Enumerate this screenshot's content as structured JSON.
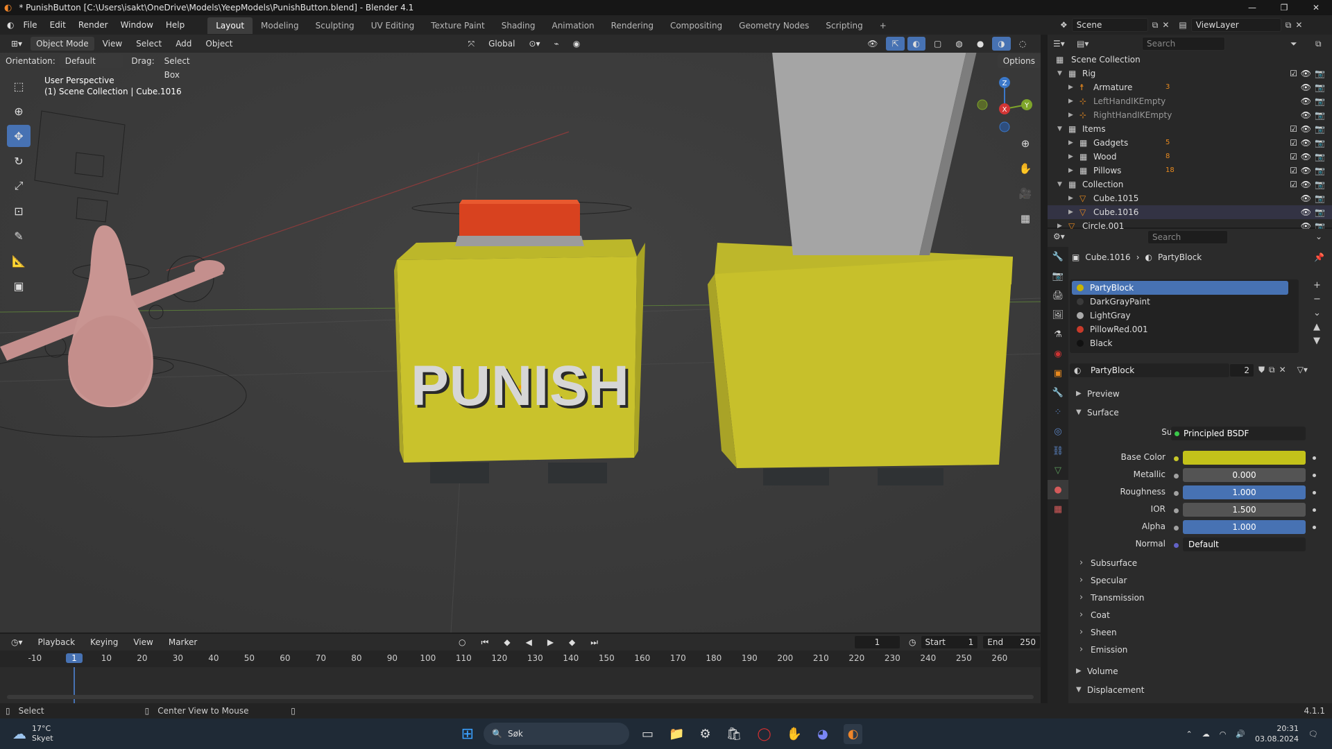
{
  "app": {
    "title": "* PunishButton [C:\\Users\\isakt\\OneDrive\\Models\\YeepModels\\PunishButton.blend] - Blender 4.1",
    "version": "4.1.1"
  },
  "window_controls": {
    "minimize": "—",
    "maximize": "❐",
    "close": "✕"
  },
  "menu": [
    "File",
    "Edit",
    "Render",
    "Window",
    "Help"
  ],
  "workspaces": {
    "items": [
      "Layout",
      "Modeling",
      "Sculpting",
      "UV Editing",
      "Texture Paint",
      "Shading",
      "Animation",
      "Rendering",
      "Compositing",
      "Geometry Nodes",
      "Scripting"
    ],
    "active": "Layout",
    "add": "+"
  },
  "scene": {
    "name": "Scene",
    "view_layer": "ViewLayer"
  },
  "viewport": {
    "mode": "Object Mode",
    "menus": [
      "View",
      "Select",
      "Add",
      "Object"
    ],
    "transform_orientation": "Global",
    "orientation_label": "Orientation:",
    "orientation_value": "Default",
    "drag_label": "Drag:",
    "drag_value": "Select Box",
    "options": "Options",
    "view_name": "User Perspective",
    "collection_info": "(1) Scene Collection | Cube.1016",
    "block_text": "PUNISH",
    "axis": {
      "x": "X",
      "y": "Y",
      "z": "Z"
    }
  },
  "timeline": {
    "menus": [
      "Playback",
      "Keying",
      "View",
      "Marker"
    ],
    "current_frame": "1",
    "start_label": "Start",
    "start": "1",
    "end_label": "End",
    "end": "250",
    "ruler": [
      "-10",
      "1",
      "10",
      "20",
      "30",
      "40",
      "50",
      "60",
      "70",
      "80",
      "90",
      "100",
      "110",
      "120",
      "130",
      "140",
      "150",
      "160",
      "170",
      "180",
      "190",
      "200",
      "210",
      "220",
      "230",
      "240",
      "250",
      "260"
    ]
  },
  "status": {
    "left": "Select",
    "middle": "Center View to Mouse",
    "version": "4.1.1"
  },
  "outliner": {
    "search_placeholder": "Search",
    "root": "Scene Collection",
    "rows": [
      {
        "label": "Rig",
        "indent": 1,
        "type": "collection",
        "badge": ""
      },
      {
        "label": "Armature",
        "indent": 2,
        "type": "armature",
        "badge": "3"
      },
      {
        "label": "LeftHandIKEmpty",
        "indent": 2,
        "type": "empty",
        "badge": "",
        "dim": true
      },
      {
        "label": "RightHandIKEmpty",
        "indent": 2,
        "type": "empty",
        "badge": "",
        "dim": true
      },
      {
        "label": "Items",
        "indent": 1,
        "type": "collection",
        "badge": ""
      },
      {
        "label": "Gadgets",
        "indent": 2,
        "type": "collection",
        "badge": "5"
      },
      {
        "label": "Wood",
        "indent": 2,
        "type": "collection",
        "badge": "8"
      },
      {
        "label": "Pillows",
        "indent": 2,
        "type": "collection",
        "badge": "18"
      },
      {
        "label": "Collection",
        "indent": 1,
        "type": "collection",
        "badge": ""
      },
      {
        "label": "Cube.1015",
        "indent": 2,
        "type": "mesh",
        "badge": ""
      },
      {
        "label": "Cube.1016",
        "indent": 2,
        "type": "mesh",
        "badge": ""
      },
      {
        "label": "Circle.001",
        "indent": 1,
        "type": "mesh",
        "badge": ""
      }
    ]
  },
  "properties": {
    "search_placeholder": "Search",
    "breadcrumb_object": "Cube.1016",
    "breadcrumb_material": "PartyBlock",
    "slots": [
      {
        "name": "PartyBlock",
        "color": "#c8b400",
        "selected": true
      },
      {
        "name": "DarkGrayPaint",
        "color": "#3a3a3a",
        "selected": false
      },
      {
        "name": "LightGray",
        "color": "#aaaaaa",
        "selected": false
      },
      {
        "name": "PillowRed.001",
        "color": "#c83a2a",
        "selected": false
      },
      {
        "name": "Black",
        "color": "#111111",
        "selected": false
      }
    ],
    "material_name": "PartyBlock",
    "users": "2",
    "sections_top": [
      "Preview",
      "Surface"
    ],
    "surface_label": "Surface",
    "surface_value": "Principled BSDF",
    "fields": [
      {
        "label": "Base Color",
        "value": "",
        "kind": "color",
        "color": "#c3c21a"
      },
      {
        "label": "Metallic",
        "value": "0.000",
        "kind": "num",
        "fill": 0
      },
      {
        "label": "Roughness",
        "value": "1.000",
        "kind": "num",
        "fill": 1
      },
      {
        "label": "IOR",
        "value": "1.500",
        "kind": "num",
        "fill": 0
      },
      {
        "label": "Alpha",
        "value": "1.000",
        "kind": "num",
        "fill": 1
      },
      {
        "label": "Normal",
        "value": "Default",
        "kind": "text"
      }
    ],
    "subsections": [
      "Subsurface",
      "Specular",
      "Transmission",
      "Coat",
      "Sheen",
      "Emission"
    ],
    "sections_bottom": [
      "Volume",
      "Displacement"
    ]
  },
  "taskbar": {
    "weather_temp": "17°C",
    "weather_text": "Skyet",
    "search": "Søk",
    "time": "20:31",
    "date": "03.08.2024"
  },
  "colors": {
    "accent": "#4772b3",
    "yellow_block": "#c6c12a",
    "red_button": "#d8421f"
  }
}
